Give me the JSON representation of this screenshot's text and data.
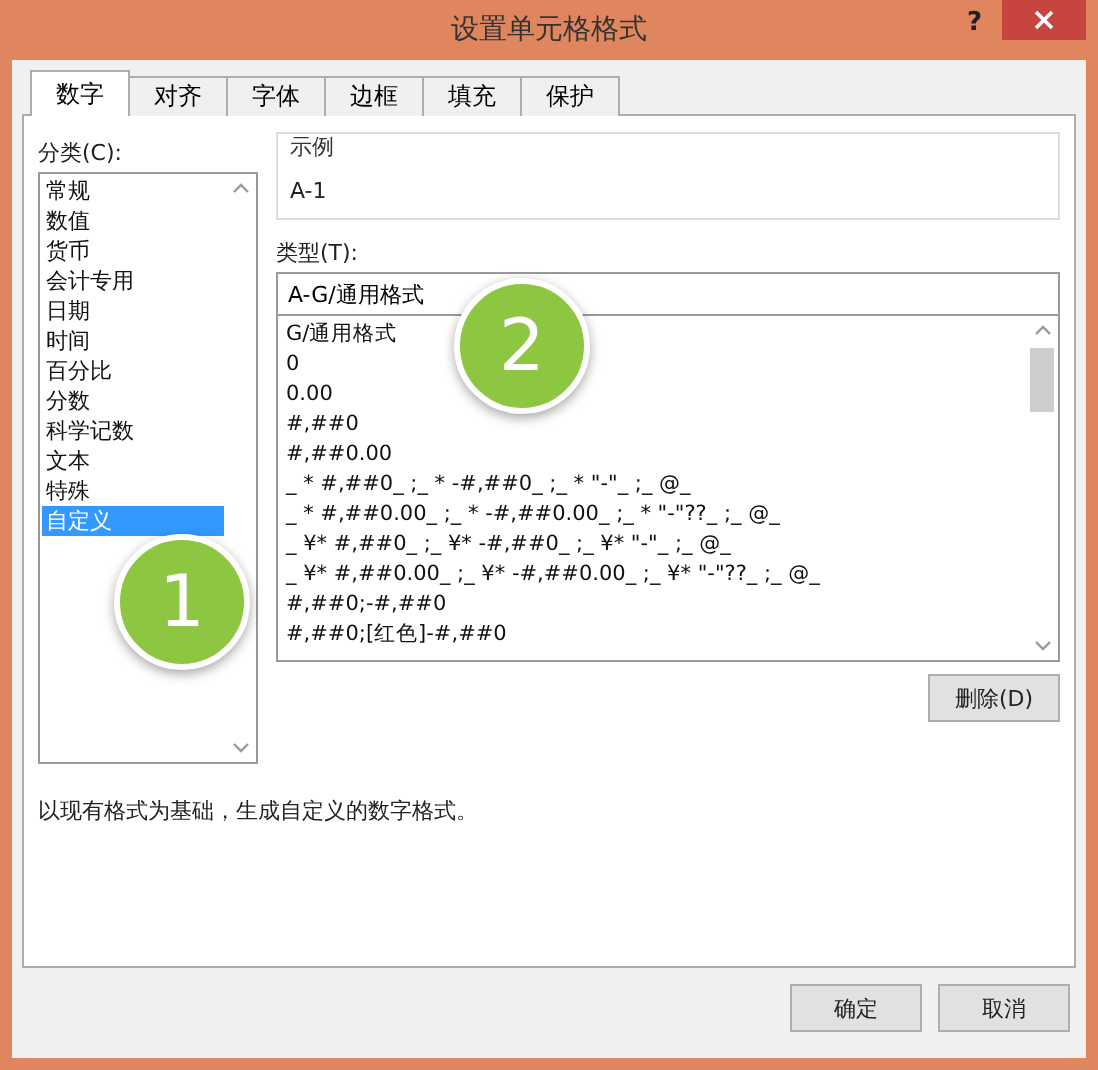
{
  "window": {
    "title": "设置单元格格式",
    "help": "?"
  },
  "tabs": [
    {
      "label": "数字",
      "selected": true
    },
    {
      "label": "对齐",
      "selected": false
    },
    {
      "label": "字体",
      "selected": false
    },
    {
      "label": "边框",
      "selected": false
    },
    {
      "label": "填充",
      "selected": false
    },
    {
      "label": "保护",
      "selected": false
    }
  ],
  "category": {
    "label": "分类(C):",
    "items": [
      {
        "label": "常规",
        "selected": false
      },
      {
        "label": "数值",
        "selected": false
      },
      {
        "label": "货币",
        "selected": false
      },
      {
        "label": "会计专用",
        "selected": false
      },
      {
        "label": "日期",
        "selected": false
      },
      {
        "label": "时间",
        "selected": false
      },
      {
        "label": "百分比",
        "selected": false
      },
      {
        "label": "分数",
        "selected": false
      },
      {
        "label": "科学记数",
        "selected": false
      },
      {
        "label": "文本",
        "selected": false
      },
      {
        "label": "特殊",
        "selected": false
      },
      {
        "label": "自定义",
        "selected": true
      }
    ]
  },
  "sample": {
    "label": "示例",
    "value": "A-1"
  },
  "type": {
    "label": "类型(T):",
    "value": "A-G/通用格式",
    "items": [
      {
        "label": "G/通用格式",
        "selected": false
      },
      {
        "label": "0",
        "selected": false
      },
      {
        "label": "0.00",
        "selected": false
      },
      {
        "label": "#,##0",
        "selected": false
      },
      {
        "label": "#,##0.00",
        "selected": false
      },
      {
        "label": "_ * #,##0_ ;_ * -#,##0_ ;_ * \"-\"_ ;_ @_",
        "selected": false
      },
      {
        "label": "_ * #,##0.00_ ;_ * -#,##0.00_ ;_ * \"-\"??_ ;_ @_",
        "selected": false
      },
      {
        "label": "_ ¥* #,##0_ ;_ ¥* -#,##0_ ;_ ¥* \"-\"_ ;_ @_",
        "selected": false
      },
      {
        "label": "_ ¥* #,##0.00_ ;_ ¥* -#,##0.00_ ;_ ¥* \"-\"??_ ;_ @_",
        "selected": false
      },
      {
        "label": "#,##0;-#,##0",
        "selected": false
      },
      {
        "label": "#,##0;[红色]-#,##0",
        "selected": false
      }
    ]
  },
  "delete_button": "删除(D)",
  "description": "以现有格式为基础，生成自定义的数字格式。",
  "buttons": [
    "确定",
    "取消"
  ],
  "callouts": [
    {
      "label": "1"
    },
    {
      "label": "2"
    }
  ]
}
